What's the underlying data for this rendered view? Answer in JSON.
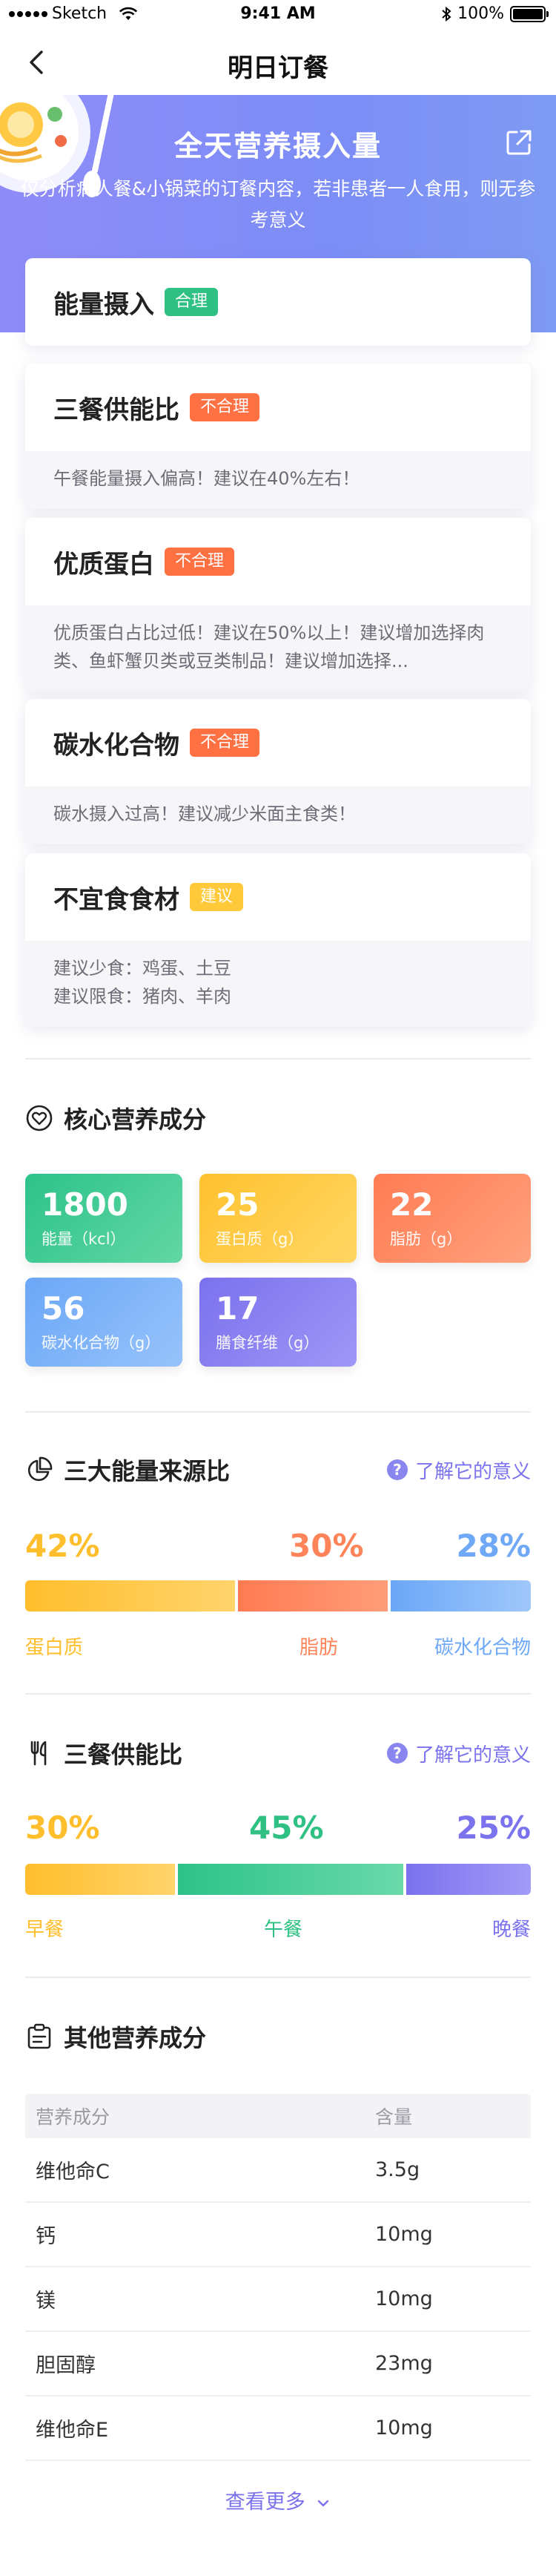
{
  "status_bar": {
    "carrier": "Sketch",
    "time": "9:41 AM",
    "battery": "100%"
  },
  "nav": {
    "title": "明日订餐"
  },
  "hero": {
    "title": "全天营养摄入量",
    "description": "仅分析病人餐&小锅菜的订餐内容，若非患者一人食用，则无参考意义"
  },
  "cards": [
    {
      "title": "能量摄入",
      "badge": "合理",
      "badge_color": "#2fc184",
      "lines": []
    },
    {
      "title": "三餐供能比",
      "badge": "不合理",
      "badge_color": "#ff7043",
      "lines": [
        "午餐能量摄入偏高！建议在40%左右！"
      ]
    },
    {
      "title": "优质蛋白",
      "badge": "不合理",
      "badge_color": "#ff7043",
      "lines": [
        "优质蛋白占比过低！建议在50%以上！建议增加选择肉类、鱼虾蟹贝类或豆类制品！建议增加选择..."
      ]
    },
    {
      "title": "碳水化合物",
      "badge": "不合理",
      "badge_color": "#ff7043",
      "lines": [
        "碳水摄入过高！建议减少米面主食类！"
      ]
    },
    {
      "title": "不宜食食材",
      "badge": "建议",
      "badge_color": "#ffc93a",
      "lines": [
        "建议少食：鸡蛋、土豆",
        "建议限食：猪肉、羊肉"
      ]
    }
  ],
  "core": {
    "title": "核心营养成分",
    "icon": "heart-icon",
    "tiles": [
      {
        "value": "1800",
        "label": "能量（kcl）",
        "color": "#2dc28a"
      },
      {
        "value": "25",
        "label": "蛋白质（g）",
        "color": "#ffc22f"
      },
      {
        "value": "22",
        "label": "脂肪（g）",
        "color": "#ff7b52"
      },
      {
        "value": "56",
        "label": "碳水化合物（g）",
        "color": "#6ba7f7"
      },
      {
        "value": "17",
        "label": "膳食纤维（g）",
        "color": "#7b71ee"
      }
    ]
  },
  "energy_ratio": {
    "title": "三大能量来源比",
    "icon": "pie-chart-icon",
    "learn_more": "了解它的意义",
    "segments": [
      {
        "label": "蛋白质",
        "percent": 42,
        "percent_text": "42%",
        "color": "#ffbe2c"
      },
      {
        "label": "脂肪",
        "percent": 30,
        "percent_text": "30%",
        "color": "#ff845a"
      },
      {
        "label": "碳水化合物",
        "percent": 28,
        "percent_text": "28%",
        "color": "#6fa8f6"
      }
    ]
  },
  "meal_ratio": {
    "title": "三餐供能比",
    "icon": "cutlery-icon",
    "learn_more": "了解它的意义",
    "segments": [
      {
        "label": "早餐",
        "percent": 30,
        "percent_text": "30%",
        "color": "#ffbe2c"
      },
      {
        "label": "午餐",
        "percent": 45,
        "percent_text": "45%",
        "color": "#2fc184"
      },
      {
        "label": "晚餐",
        "percent": 25,
        "percent_text": "25%",
        "color": "#7b72ee"
      }
    ]
  },
  "other": {
    "title": "其他营养成分",
    "icon": "clipboard-icon",
    "columns": [
      "营养成分",
      "含量"
    ],
    "rows": [
      [
        "维他命C",
        "3.5g"
      ],
      [
        "钙",
        "10mg"
      ],
      [
        "镁",
        "10mg"
      ],
      [
        "胆固醇",
        "23mg"
      ],
      [
        "维他命E",
        "10mg"
      ]
    ],
    "more": "查看更多"
  }
}
